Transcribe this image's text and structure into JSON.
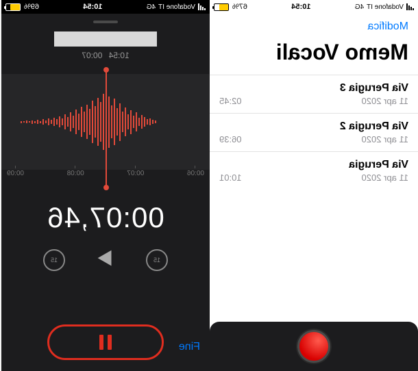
{
  "status": {
    "carrier": "Vodafone IT",
    "network": "4G",
    "time": "10:54",
    "battery_left": "67%",
    "battery_right": "69%"
  },
  "list_screen": {
    "edit": "Modifica",
    "title": "Memo Vocali",
    "items": [
      {
        "title": "Via Perugia 3",
        "date": "11 apr 2020",
        "duration": "02:45"
      },
      {
        "title": "Via Perugia 2",
        "date": "11 apr 2020",
        "duration": "06:39"
      },
      {
        "title": "Via Perugia",
        "date": "11 apr 2020",
        "duration": "10:01"
      }
    ]
  },
  "recorder": {
    "header_time": "10:54",
    "header_duration": "00:07",
    "timer": "00:07,46",
    "done": "Fine",
    "skip_amount": "15",
    "ruler": [
      "00:06",
      "00:07",
      "00:08",
      "00:09"
    ]
  }
}
